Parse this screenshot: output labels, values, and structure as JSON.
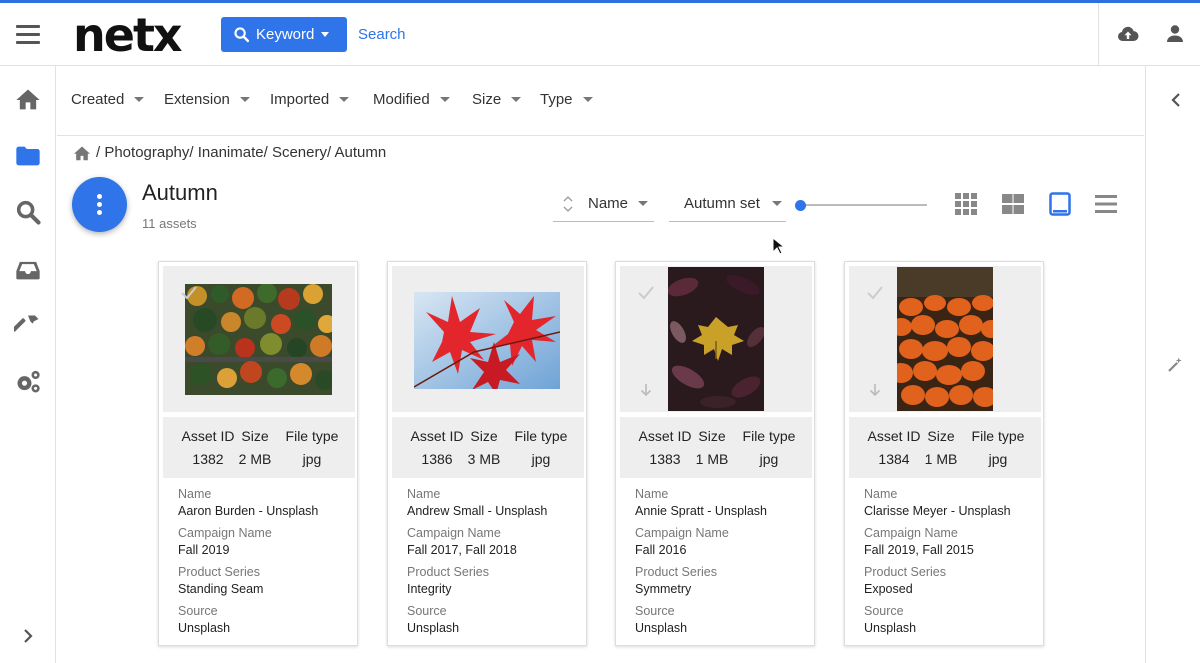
{
  "app": {
    "logo_text": "netx",
    "accent_color": "#2f74e8"
  },
  "header": {
    "keyword_button_label": "Keyword",
    "search_placeholder": "Search"
  },
  "filters": [
    "Created",
    "Extension",
    "Imported",
    "Modified",
    "Size",
    "Type"
  ],
  "breadcrumb": "/ Photography/ Inanimate/ Scenery/ Autumn",
  "folder": {
    "title": "Autumn",
    "count": "11 assets"
  },
  "sort": {
    "field": "Name",
    "set": "Autumn set",
    "thumb_size_fraction": 0.0
  },
  "view_modes": [
    "grid-small",
    "grid-large",
    "tile",
    "list"
  ],
  "selected_view": "tile",
  "meta_headers": [
    "Asset ID",
    "Size",
    "File type"
  ],
  "field_labels": {
    "name": "Name",
    "campaign": "Campaign Name",
    "series": "Product Series",
    "source": "Source"
  },
  "assets": [
    {
      "id": "1382",
      "size": "2 MB",
      "type": "jpg",
      "name": "Aaron Burden - Unsplash",
      "campaign": "Fall 2019",
      "series": "Standing Seam",
      "source": "Unsplash"
    },
    {
      "id": "1386",
      "size": "3 MB",
      "type": "jpg",
      "name": "Andrew Small - Unsplash",
      "campaign": "Fall 2017, Fall 2018",
      "series": "Integrity",
      "source": "Unsplash"
    },
    {
      "id": "1383",
      "size": "1 MB",
      "type": "jpg",
      "name": "Annie Spratt - Unsplash",
      "campaign": "Fall 2016",
      "series": "Symmetry",
      "source": "Unsplash"
    },
    {
      "id": "1384",
      "size": "1 MB",
      "type": "jpg",
      "name": "Clarisse Meyer - Unsplash",
      "campaign": "Fall 2019, Fall 2015",
      "series": "Exposed",
      "source": "Unsplash"
    }
  ]
}
